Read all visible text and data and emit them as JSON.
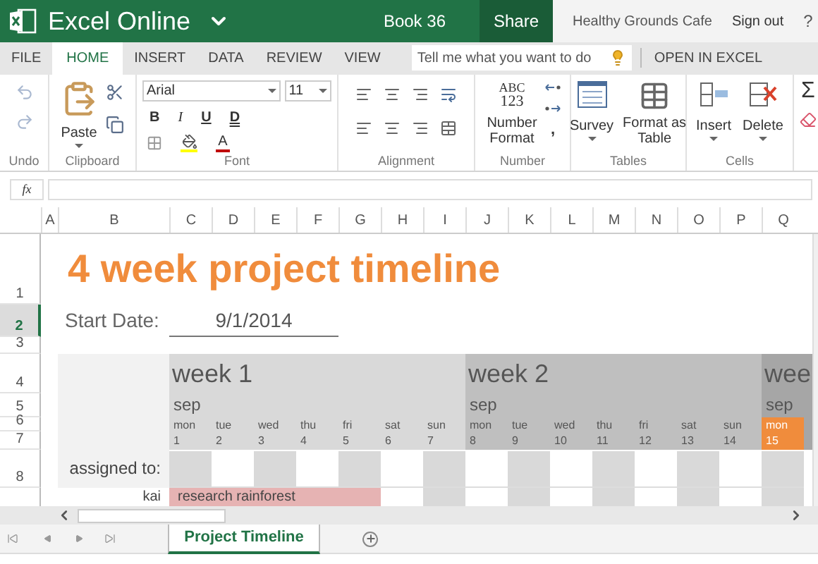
{
  "app": {
    "name": "Excel Online",
    "document": "Book 36",
    "share": "Share",
    "account": "Healthy Grounds Cafe",
    "sign_out": "Sign out",
    "help": "?"
  },
  "tabs": [
    {
      "label": "FILE",
      "selected": false
    },
    {
      "label": "HOME",
      "selected": true
    },
    {
      "label": "INSERT",
      "selected": false
    },
    {
      "label": "DATA",
      "selected": false
    },
    {
      "label": "REVIEW",
      "selected": false
    },
    {
      "label": "VIEW",
      "selected": false
    }
  ],
  "tell_me": {
    "placeholder": "Tell me what you want to do"
  },
  "open_in_excel": "OPEN IN EXCEL",
  "ribbon": {
    "groups": [
      "Undo",
      "Clipboard",
      "Font",
      "Alignment",
      "Number",
      "Tables",
      "Cells"
    ],
    "paste": "Paste",
    "font": {
      "name": "Arial",
      "size": "11",
      "styles": [
        "B",
        "I",
        "U",
        "D"
      ],
      "font_color": "A"
    },
    "number": {
      "glyph": [
        "ABC",
        "123"
      ],
      "label": "Number Format",
      "comma": ","
    },
    "survey": "Survey",
    "format_table": "Format as Table",
    "insert": "Insert",
    "delete": "Delete",
    "sum": "Σ"
  },
  "formula_bar": {
    "fx": "fx"
  },
  "columns": [
    "A",
    "B",
    "C",
    "D",
    "E",
    "F",
    "G",
    "H",
    "I",
    "J",
    "K",
    "L",
    "M",
    "N",
    "O",
    "P",
    "Q"
  ],
  "rows": [
    {
      "label": "1",
      "selected": false
    },
    {
      "label": "2",
      "selected": true
    },
    {
      "label": "3",
      "selected": false
    },
    {
      "label": "4",
      "selected": false
    },
    {
      "label": "5",
      "selected": false
    },
    {
      "label": "6",
      "selected": false
    },
    {
      "label": "7",
      "selected": false
    },
    {
      "label": "8",
      "selected": false
    }
  ],
  "sheet": {
    "title": "4 week project timeline",
    "start_label": "Start Date:",
    "start_date": "9/1/2014",
    "weeks": [
      {
        "label": "week 1",
        "month": "sep",
        "days": [
          {
            "name": "mon",
            "date": "1",
            "today": false
          },
          {
            "name": "tue",
            "date": "2",
            "today": false
          },
          {
            "name": "wed",
            "date": "3",
            "today": false
          },
          {
            "name": "thu",
            "date": "4",
            "today": false
          },
          {
            "name": "fri",
            "date": "5",
            "today": false
          },
          {
            "name": "sat",
            "date": "6",
            "today": false
          },
          {
            "name": "sun",
            "date": "7",
            "today": false
          }
        ]
      },
      {
        "label": "week 2",
        "month": "sep",
        "days": [
          {
            "name": "mon",
            "date": "8",
            "today": false
          },
          {
            "name": "tue",
            "date": "9",
            "today": false
          },
          {
            "name": "wed",
            "date": "10",
            "today": false
          },
          {
            "name": "thu",
            "date": "11",
            "today": false
          },
          {
            "name": "fri",
            "date": "12",
            "today": false
          },
          {
            "name": "sat",
            "date": "13",
            "today": false
          },
          {
            "name": "sun",
            "date": "14",
            "today": false
          }
        ]
      },
      {
        "label": "wee",
        "month": "sep",
        "days": [
          {
            "name": "mon",
            "date": "15",
            "today": true
          }
        ]
      }
    ],
    "assigned_label": "assigned to:",
    "tasks": [
      {
        "person": "kai",
        "task": "research rainforest"
      }
    ]
  },
  "sheet_tabs": [
    {
      "label": "Project Timeline",
      "selected": true
    }
  ]
}
